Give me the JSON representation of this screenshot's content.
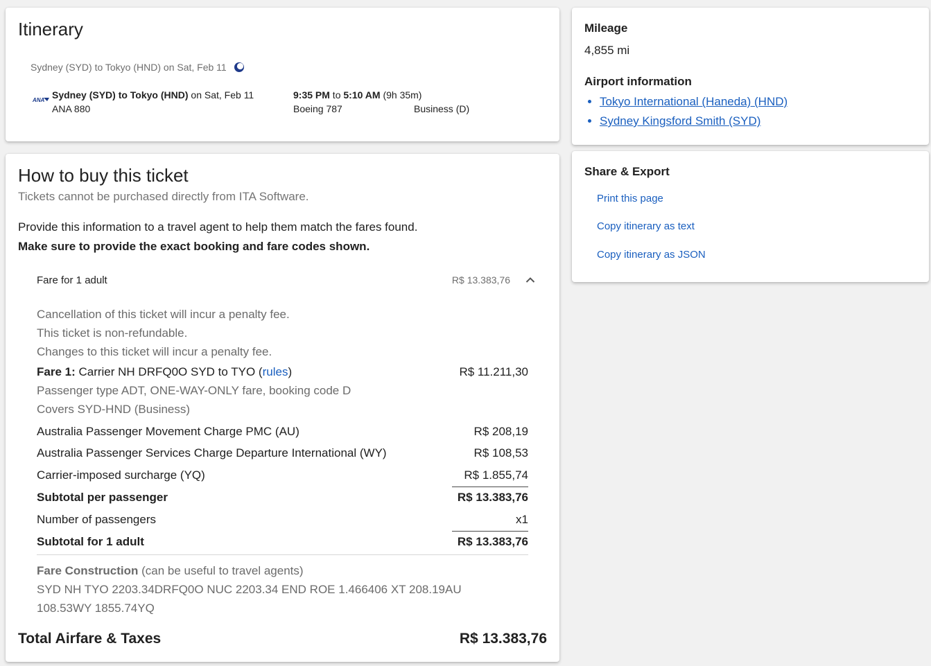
{
  "itinerary": {
    "title": "Itinerary",
    "route_summary": "Sydney (SYD) to Tokyo (HND) on Sat, Feb 11",
    "flight": {
      "airline_logo_text": "ANA",
      "route_bold": "Sydney (SYD) to Tokyo (HND)",
      "route_date": " on Sat, Feb 11",
      "flight_number": "ANA 880",
      "depart": "9:35 PM",
      "to": " to ",
      "arrive": "5:10 AM",
      "duration": " (9h 35m)",
      "aircraft": "Boeing 787",
      "cabin": "Business (D)"
    }
  },
  "buy": {
    "title": "How to buy this ticket",
    "subtitle": "Tickets cannot be purchased directly from ITA Software.",
    "instruction": "Provide this information to a travel agent to help them match the fares found.",
    "instruction_bold": "Make sure to provide the exact booking and fare codes shown.",
    "fare_header_label": "Fare for 1 adult",
    "fare_header_amount": "R$ 13.383,76",
    "penalties": [
      "Cancellation of this ticket will incur a penalty fee.",
      "This ticket is non-refundable.",
      "Changes to this ticket will incur a penalty fee."
    ],
    "fare1": {
      "label": "Fare 1:",
      "text": " Carrier NH DRFQ0O SYD to TYO (",
      "rules_link": "rules",
      "close": ")",
      "amount": "R$ 11.211,30",
      "passenger_line": "Passenger type ADT, ONE-WAY-ONLY fare, booking code D",
      "covers_line": "Covers SYD-HND (Business)"
    },
    "taxes": [
      {
        "label": "Australia Passenger Movement Charge PMC (AU)",
        "amount": "R$ 208,19"
      },
      {
        "label": "Australia Passenger Services Charge Departure International (WY)",
        "amount": "R$ 108,53"
      },
      {
        "label": "Carrier-imposed surcharge (YQ)",
        "amount": "R$ 1.855,74"
      }
    ],
    "subtotal_per_passenger": {
      "label": "Subtotal per passenger",
      "amount": "R$ 13.383,76"
    },
    "num_passengers": {
      "label": "Number of passengers",
      "amount": "x1"
    },
    "subtotal_adult": {
      "label": "Subtotal for 1 adult",
      "amount": "R$ 13.383,76"
    },
    "fare_construction": {
      "label": "Fare Construction",
      "note": " (can be useful to travel agents)",
      "line1": "SYD NH TYO 2203.34DRFQ0O NUC 2203.34 END ROE 1.466406 XT 208.19AU",
      "line2": "108.53WY 1855.74YQ"
    },
    "total": {
      "label": "Total Airfare & Taxes",
      "amount": "R$ 13.383,76"
    }
  },
  "info": {
    "mileage_heading": "Mileage",
    "mileage_value": "4,855 mi",
    "airport_heading": "Airport information",
    "airports": [
      "Tokyo International (Haneda) (HND)",
      "Sydney Kingsford Smith (SYD)"
    ]
  },
  "share": {
    "heading": "Share & Export",
    "actions": [
      "Print this page",
      "Copy itinerary as text",
      "Copy itinerary as JSON"
    ]
  },
  "colors": {
    "link": "#1a5fbf",
    "background": "#f1f1f1",
    "moon": "#1f3a8a"
  },
  "icons": [
    "moon-icon",
    "airline-logo",
    "chevron-up-icon"
  ]
}
